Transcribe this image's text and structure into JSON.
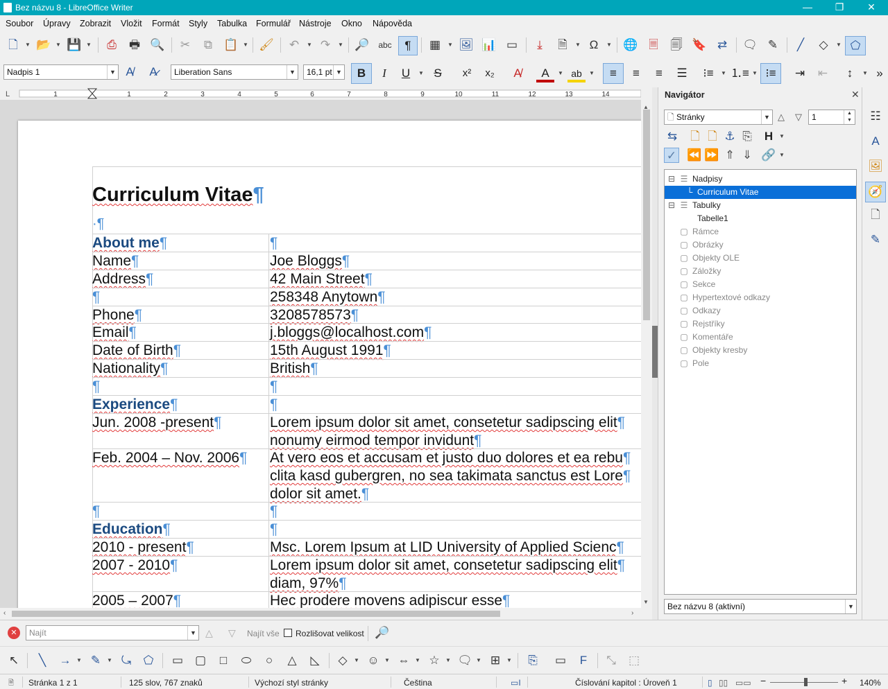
{
  "window": {
    "title": "Bez názvu 8 - LibreOffice Writer"
  },
  "menu": [
    "Soubor",
    "Úpravy",
    "Zobrazit",
    "Vložit",
    "Formát",
    "Styly",
    "Tabulka",
    "Formulář",
    "Nástroje",
    "Okno",
    "Nápověda"
  ],
  "format": {
    "paragraph_style": "Nadpis 1",
    "font_name": "Liberation Sans",
    "font_size": "16,1 pt"
  },
  "document": {
    "title": "Curriculum Vitae",
    "rows": [
      {
        "left": "About me",
        "right": "",
        "header": true
      },
      {
        "left": "Name",
        "right": "Joe Bloggs"
      },
      {
        "left": "Address",
        "right": "42 Main Street"
      },
      {
        "left": "",
        "right": "258348 Anytown"
      },
      {
        "left": "Phone",
        "right": "3208578573"
      },
      {
        "left": "Email",
        "right": "j.bloggs@localhost.com"
      },
      {
        "left": "Date of Birth",
        "right": "15th August 1991"
      },
      {
        "left": "Nationality",
        "right": "British"
      },
      {
        "left": "",
        "right": ""
      },
      {
        "left": "Experience",
        "right": "",
        "header": true
      },
      {
        "left": "Jun. 2008 -present",
        "right": "Lorem ipsum dolor sit amet, consetetur sadipscing elit",
        "right2": "nonumy eirmod tempor invidunt"
      },
      {
        "left": "Feb. 2004 – Nov. 2006",
        "right": "At vero eos et accusam et justo duo dolores et ea rebu",
        "right2": "clita kasd gubergren, no sea takimata sanctus est Lore",
        "right3": "dolor sit amet."
      },
      {
        "left": "",
        "right": ""
      },
      {
        "left": "Education",
        "right": "",
        "header": true
      },
      {
        "left": "2010 - present",
        "right": "Msc. Lorem Ipsum at LID University of Applied Scienc"
      },
      {
        "left": "2007 - 2010",
        "right": "Lorem ipsum dolor sit amet, consetetur sadipscing elit",
        "right2": "diam, 97%"
      },
      {
        "left": "2005 – 2007",
        "right": "Hec prodere movens adipiscur esse"
      }
    ]
  },
  "navigator": {
    "title": "Navigátor",
    "category": "Stránky",
    "page": "1",
    "tree": [
      {
        "label": "Nadpisy",
        "level": 0,
        "expand": "⊟"
      },
      {
        "label": "Curriculum Vitae",
        "level": 1,
        "selected": true
      },
      {
        "label": "Tabulky",
        "level": 0,
        "expand": "⊟"
      },
      {
        "label": "Tabelle1",
        "level": 1
      },
      {
        "label": "Rámce",
        "level": 0,
        "dim": true
      },
      {
        "label": "Obrázky",
        "level": 0,
        "dim": true
      },
      {
        "label": "Objekty OLE",
        "level": 0,
        "dim": true
      },
      {
        "label": "Záložky",
        "level": 0,
        "dim": true
      },
      {
        "label": "Sekce",
        "level": 0,
        "dim": true
      },
      {
        "label": "Hypertextové odkazy",
        "level": 0,
        "dim": true
      },
      {
        "label": "Odkazy",
        "level": 0,
        "dim": true
      },
      {
        "label": "Rejstříky",
        "level": 0,
        "dim": true
      },
      {
        "label": "Komentáře",
        "level": 0,
        "dim": true
      },
      {
        "label": "Objekty kresby",
        "level": 0,
        "dim": true
      },
      {
        "label": "Pole",
        "level": 0,
        "dim": true
      }
    ],
    "document_select": "Bez názvu 8 (aktivní)"
  },
  "find": {
    "placeholder": "Najít",
    "find_all": "Najít vše",
    "match_case": "Rozlišovat velikost"
  },
  "status": {
    "page": "Stránka 1 z 1",
    "words": "125 slov, 767 znaků",
    "page_style": "Výchozí styl stránky",
    "language": "Čeština",
    "outline": "Číslování kapitol : Úroveň 1",
    "zoom": "140%"
  }
}
